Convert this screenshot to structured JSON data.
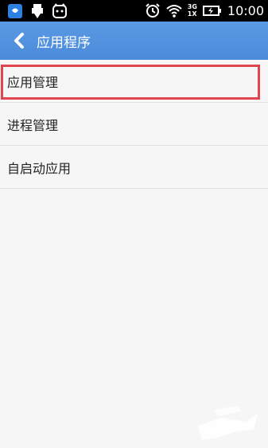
{
  "statusbar": {
    "left_icons": [
      "qq-icon",
      "usb-icon",
      "notification-icon"
    ],
    "right_icons": [
      "alarm-icon",
      "wifi-icon",
      "network-3g-1x-icon",
      "battery-icon"
    ],
    "network_top": "3G",
    "network_bottom": "1X",
    "time": "10:00"
  },
  "actionbar": {
    "title": "应用程序"
  },
  "list": {
    "items": [
      {
        "label": "应用管理"
      },
      {
        "label": "进程管理"
      },
      {
        "label": "自启动应用"
      }
    ]
  },
  "colors": {
    "actionbar": "#4a8ad9",
    "highlight": "#e04550"
  }
}
